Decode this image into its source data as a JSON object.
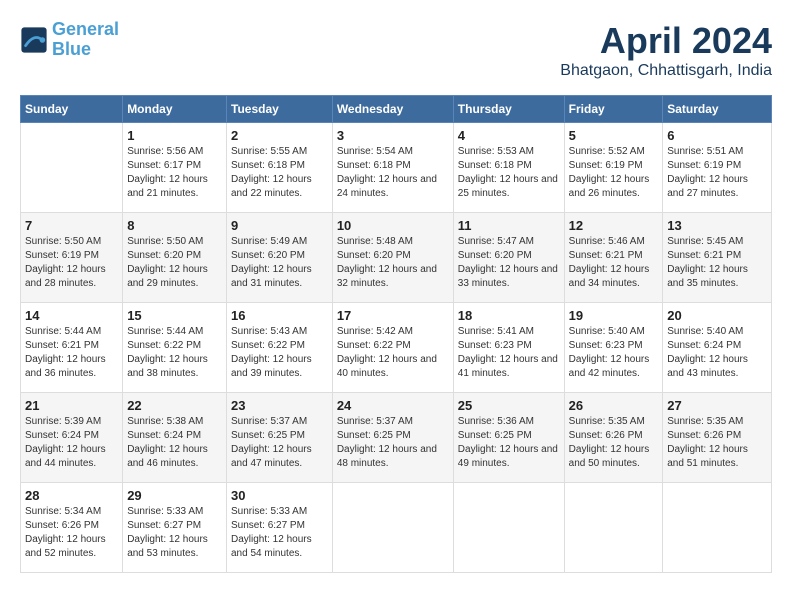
{
  "header": {
    "logo_line1": "General",
    "logo_line2": "Blue",
    "month_title": "April 2024",
    "subtitle": "Bhatgaon, Chhattisgarh, India"
  },
  "weekdays": [
    "Sunday",
    "Monday",
    "Tuesday",
    "Wednesday",
    "Thursday",
    "Friday",
    "Saturday"
  ],
  "weeks": [
    [
      {
        "day": "",
        "info": ""
      },
      {
        "day": "1",
        "info": "Sunrise: 5:56 AM\nSunset: 6:17 PM\nDaylight: 12 hours\nand 21 minutes."
      },
      {
        "day": "2",
        "info": "Sunrise: 5:55 AM\nSunset: 6:18 PM\nDaylight: 12 hours\nand 22 minutes."
      },
      {
        "day": "3",
        "info": "Sunrise: 5:54 AM\nSunset: 6:18 PM\nDaylight: 12 hours\nand 24 minutes."
      },
      {
        "day": "4",
        "info": "Sunrise: 5:53 AM\nSunset: 6:18 PM\nDaylight: 12 hours\nand 25 minutes."
      },
      {
        "day": "5",
        "info": "Sunrise: 5:52 AM\nSunset: 6:19 PM\nDaylight: 12 hours\nand 26 minutes."
      },
      {
        "day": "6",
        "info": "Sunrise: 5:51 AM\nSunset: 6:19 PM\nDaylight: 12 hours\nand 27 minutes."
      }
    ],
    [
      {
        "day": "7",
        "info": "Sunrise: 5:50 AM\nSunset: 6:19 PM\nDaylight: 12 hours\nand 28 minutes."
      },
      {
        "day": "8",
        "info": "Sunrise: 5:50 AM\nSunset: 6:20 PM\nDaylight: 12 hours\nand 29 minutes."
      },
      {
        "day": "9",
        "info": "Sunrise: 5:49 AM\nSunset: 6:20 PM\nDaylight: 12 hours\nand 31 minutes."
      },
      {
        "day": "10",
        "info": "Sunrise: 5:48 AM\nSunset: 6:20 PM\nDaylight: 12 hours\nand 32 minutes."
      },
      {
        "day": "11",
        "info": "Sunrise: 5:47 AM\nSunset: 6:20 PM\nDaylight: 12 hours\nand 33 minutes."
      },
      {
        "day": "12",
        "info": "Sunrise: 5:46 AM\nSunset: 6:21 PM\nDaylight: 12 hours\nand 34 minutes."
      },
      {
        "day": "13",
        "info": "Sunrise: 5:45 AM\nSunset: 6:21 PM\nDaylight: 12 hours\nand 35 minutes."
      }
    ],
    [
      {
        "day": "14",
        "info": "Sunrise: 5:44 AM\nSunset: 6:21 PM\nDaylight: 12 hours\nand 36 minutes."
      },
      {
        "day": "15",
        "info": "Sunrise: 5:44 AM\nSunset: 6:22 PM\nDaylight: 12 hours\nand 38 minutes."
      },
      {
        "day": "16",
        "info": "Sunrise: 5:43 AM\nSunset: 6:22 PM\nDaylight: 12 hours\nand 39 minutes."
      },
      {
        "day": "17",
        "info": "Sunrise: 5:42 AM\nSunset: 6:22 PM\nDaylight: 12 hours\nand 40 minutes."
      },
      {
        "day": "18",
        "info": "Sunrise: 5:41 AM\nSunset: 6:23 PM\nDaylight: 12 hours\nand 41 minutes."
      },
      {
        "day": "19",
        "info": "Sunrise: 5:40 AM\nSunset: 6:23 PM\nDaylight: 12 hours\nand 42 minutes."
      },
      {
        "day": "20",
        "info": "Sunrise: 5:40 AM\nSunset: 6:24 PM\nDaylight: 12 hours\nand 43 minutes."
      }
    ],
    [
      {
        "day": "21",
        "info": "Sunrise: 5:39 AM\nSunset: 6:24 PM\nDaylight: 12 hours\nand 44 minutes."
      },
      {
        "day": "22",
        "info": "Sunrise: 5:38 AM\nSunset: 6:24 PM\nDaylight: 12 hours\nand 46 minutes."
      },
      {
        "day": "23",
        "info": "Sunrise: 5:37 AM\nSunset: 6:25 PM\nDaylight: 12 hours\nand 47 minutes."
      },
      {
        "day": "24",
        "info": "Sunrise: 5:37 AM\nSunset: 6:25 PM\nDaylight: 12 hours\nand 48 minutes."
      },
      {
        "day": "25",
        "info": "Sunrise: 5:36 AM\nSunset: 6:25 PM\nDaylight: 12 hours\nand 49 minutes."
      },
      {
        "day": "26",
        "info": "Sunrise: 5:35 AM\nSunset: 6:26 PM\nDaylight: 12 hours\nand 50 minutes."
      },
      {
        "day": "27",
        "info": "Sunrise: 5:35 AM\nSunset: 6:26 PM\nDaylight: 12 hours\nand 51 minutes."
      }
    ],
    [
      {
        "day": "28",
        "info": "Sunrise: 5:34 AM\nSunset: 6:26 PM\nDaylight: 12 hours\nand 52 minutes."
      },
      {
        "day": "29",
        "info": "Sunrise: 5:33 AM\nSunset: 6:27 PM\nDaylight: 12 hours\nand 53 minutes."
      },
      {
        "day": "30",
        "info": "Sunrise: 5:33 AM\nSunset: 6:27 PM\nDaylight: 12 hours\nand 54 minutes."
      },
      {
        "day": "",
        "info": ""
      },
      {
        "day": "",
        "info": ""
      },
      {
        "day": "",
        "info": ""
      },
      {
        "day": "",
        "info": ""
      }
    ]
  ]
}
